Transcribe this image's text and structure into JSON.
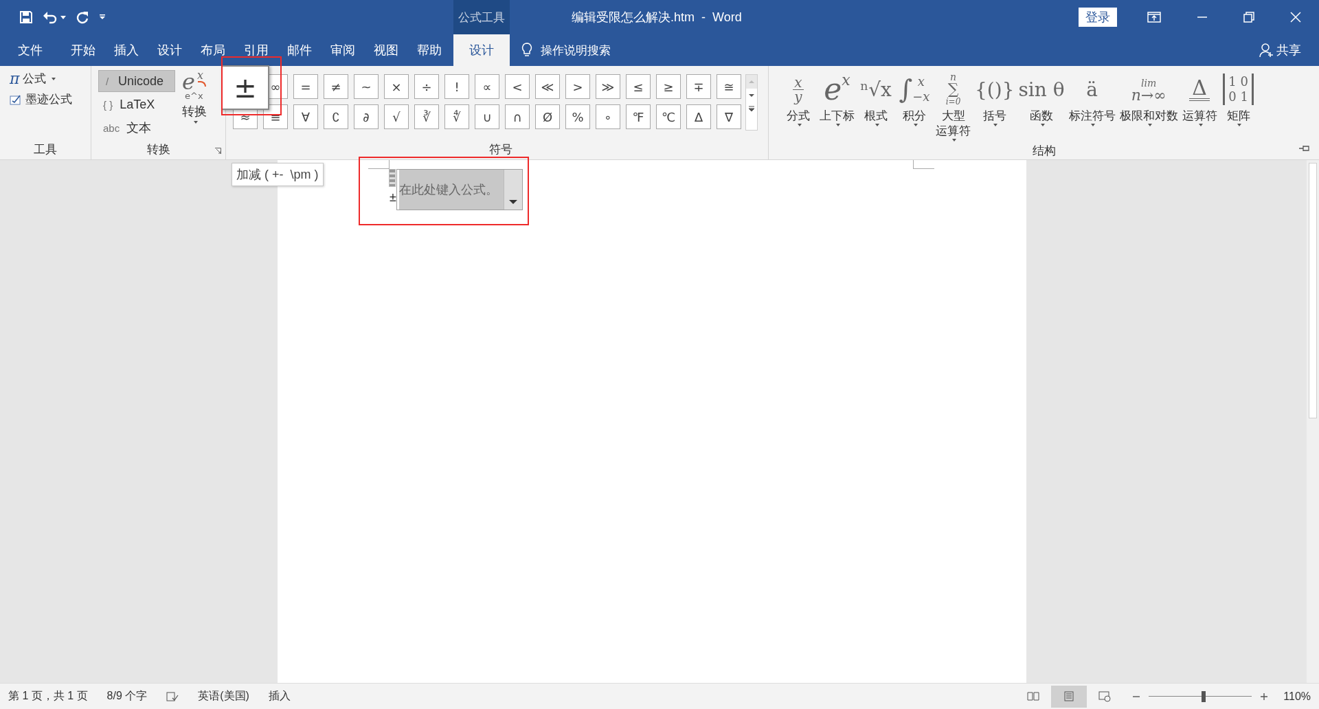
{
  "title_bar": {
    "context_group": "公式工具",
    "title": "编辑受限怎么解决.htm  -  Word",
    "sign_in": "登录"
  },
  "tabs": [
    {
      "label": "文件",
      "selected": false
    },
    {
      "label": "开始",
      "selected": false
    },
    {
      "label": "插入",
      "selected": false
    },
    {
      "label": "设计",
      "selected": false
    },
    {
      "label": "布局",
      "selected": false
    },
    {
      "label": "引用",
      "selected": false
    },
    {
      "label": "邮件",
      "selected": false
    },
    {
      "label": "审阅",
      "selected": false
    },
    {
      "label": "视图",
      "selected": false
    },
    {
      "label": "帮助",
      "selected": false
    },
    {
      "label": "设计",
      "selected": true
    }
  ],
  "tell_me": "操作说明搜索",
  "share": "共享",
  "tools_group": {
    "label": "工具",
    "equation": {
      "glyph": "π",
      "label": "公式"
    },
    "ink": {
      "label": "墨迹公式"
    }
  },
  "convert_group": {
    "label": "转换",
    "formats": [
      {
        "prefix": "/",
        "label": "Unicode",
        "selected": true
      },
      {
        "prefix": "{ }",
        "label": "LaTeX",
        "selected": false
      },
      {
        "prefix": "abc",
        "label": "文本",
        "selected": false
      }
    ],
    "convert": {
      "base": "e",
      "sup": "x",
      "caption": "e^x",
      "label": "转换"
    }
  },
  "symbols_group": {
    "label": "符号",
    "rows": [
      [
        {
          "symbol": "±",
          "hovered": true,
          "highlighted": true
        },
        {
          "symbol": "∞",
          "hovered": false
        },
        {
          "symbol": "=",
          "hovered": false
        },
        {
          "symbol": "≠",
          "hovered": false
        },
        {
          "symbol": "~",
          "hovered": false
        },
        {
          "symbol": "×",
          "hovered": false
        },
        {
          "symbol": "÷",
          "hovered": false
        },
        {
          "symbol": "!",
          "hovered": false
        },
        {
          "symbol": "∝",
          "hovered": false
        },
        {
          "symbol": "<",
          "hovered": false
        },
        {
          "symbol": "≪",
          "hovered": false
        },
        {
          "symbol": ">",
          "hovered": false
        },
        {
          "symbol": "≫",
          "hovered": false
        },
        {
          "symbol": "≤",
          "hovered": false
        },
        {
          "symbol": "≥",
          "hovered": false
        },
        {
          "symbol": "∓",
          "hovered": false
        },
        {
          "symbol": "≅",
          "hovered": false
        }
      ],
      [
        {
          "symbol": "≈",
          "hovered": false
        },
        {
          "symbol": "≡",
          "hovered": false
        },
        {
          "symbol": "∀",
          "hovered": false
        },
        {
          "symbol": "∁",
          "hovered": false
        },
        {
          "symbol": "∂",
          "hovered": false
        },
        {
          "symbol": "√",
          "hovered": false
        },
        {
          "symbol": "∛",
          "hovered": false
        },
        {
          "symbol": "∜",
          "hovered": false
        },
        {
          "symbol": "∪",
          "hovered": false
        },
        {
          "symbol": "∩",
          "hovered": false
        },
        {
          "symbol": "Ø",
          "hovered": false
        },
        {
          "symbol": "%",
          "hovered": false
        },
        {
          "symbol": "∘",
          "hovered": false
        },
        {
          "symbol": "℉",
          "hovered": false
        },
        {
          "symbol": "℃",
          "hovered": false
        },
        {
          "symbol": "∆",
          "hovered": false
        },
        {
          "symbol": "∇",
          "hovered": false
        }
      ]
    ]
  },
  "tooltip": "加减 ( +-  \\pm )",
  "structures_group": {
    "label": "结构",
    "items": [
      {
        "kind": "fraction",
        "parts": [
          "x",
          "y"
        ],
        "label": "分式"
      },
      {
        "kind": "script",
        "parts": [
          "e",
          "x"
        ],
        "label": "上下标"
      },
      {
        "kind": "plain",
        "parts": [
          "ⁿ√x"
        ],
        "label": "根式"
      },
      {
        "kind": "integral",
        "parts": [
          "∫",
          "x",
          "−x"
        ],
        "label": "积分"
      },
      {
        "kind": "stack",
        "parts": [
          "n",
          "∑",
          "i=0"
        ],
        "label_lines": [
          "大型",
          "运算符"
        ]
      },
      {
        "kind": "plain",
        "parts": [
          "{()}"
        ],
        "label": "括号"
      },
      {
        "kind": "plain",
        "parts": [
          "sin θ"
        ],
        "label": "函数"
      },
      {
        "kind": "plain",
        "parts": [
          "ä"
        ],
        "label": "标注符号"
      },
      {
        "kind": "stack",
        "parts": [
          "lim",
          "n→∞"
        ],
        "label": "极限和对数"
      },
      {
        "kind": "operator",
        "parts": [
          "Δ"
        ],
        "label": "运算符"
      },
      {
        "kind": "matrix",
        "parts": [
          "1 0",
          "0 1"
        ],
        "label": "矩阵"
      }
    ]
  },
  "document": {
    "equation": {
      "prefix": "±",
      "placeholder": "在此处键入公式。",
      "highlighted": true
    }
  },
  "status_bar": {
    "page": "第 1 页，共 1 页",
    "words": "8/9 个字",
    "language": "英语(美国)",
    "mode": "插入",
    "views": [
      {
        "kind": "read",
        "selected": false
      },
      {
        "kind": "print",
        "selected": true
      },
      {
        "kind": "web",
        "selected": false
      }
    ],
    "zoom": {
      "level": 0.53,
      "reading": "110%"
    }
  }
}
